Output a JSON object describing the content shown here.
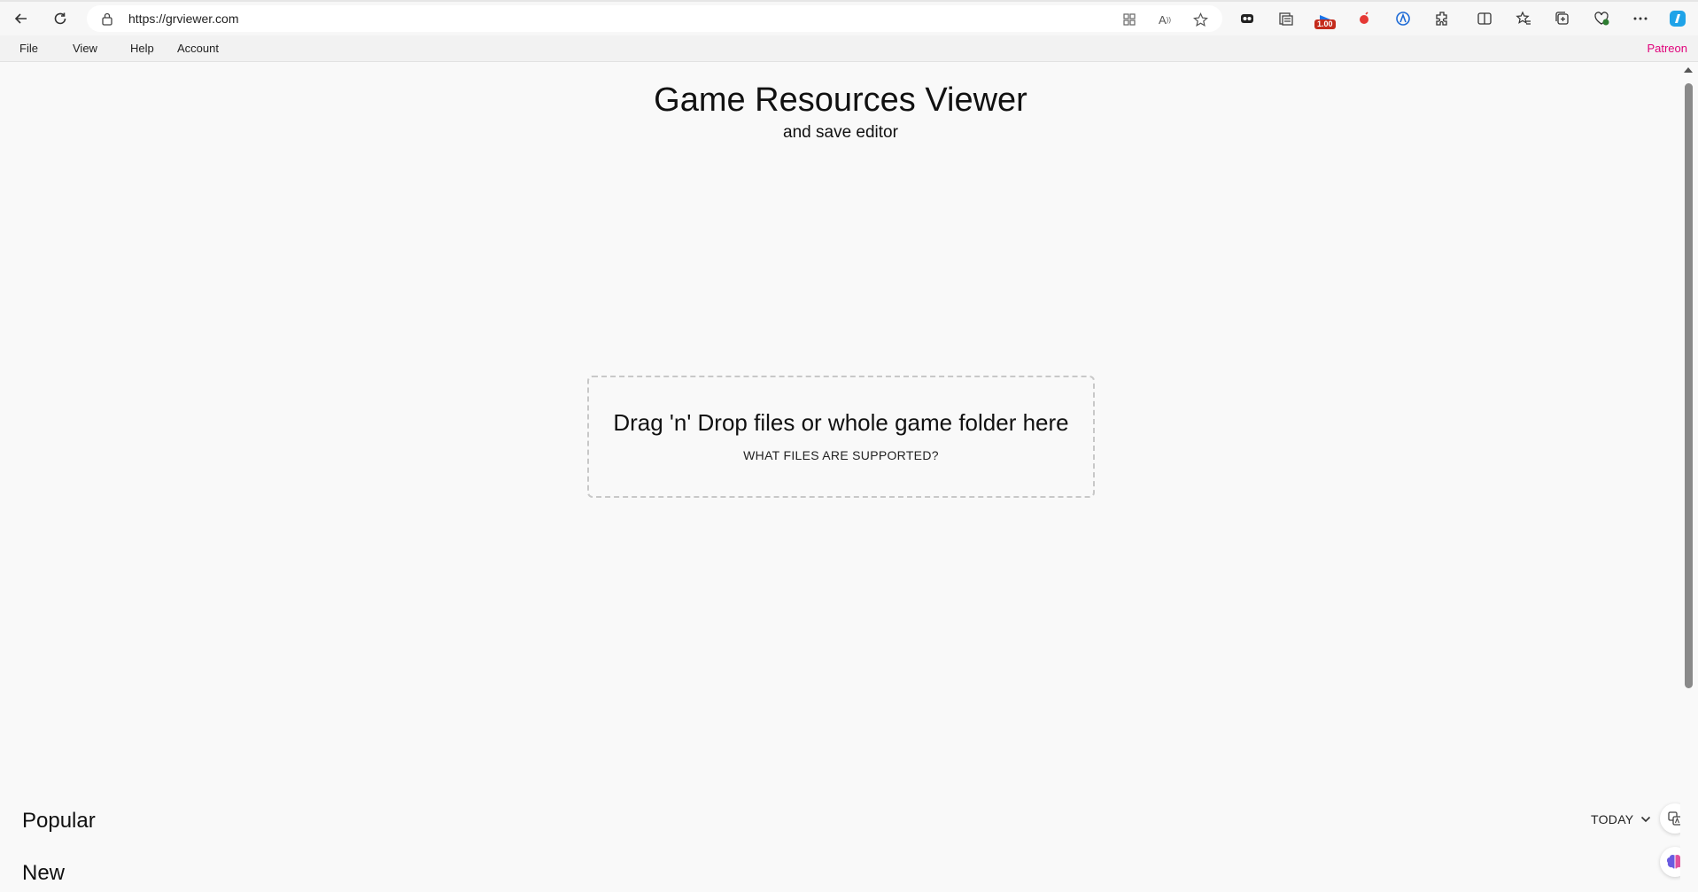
{
  "browser": {
    "url": "https://grviewer.com",
    "extension_badge": "1.00",
    "icons": [
      "back-icon",
      "refresh-icon",
      "lock-icon",
      "app-available-icon",
      "read-aloud-icon",
      "favorite-star-icon",
      "extension-1-icon",
      "extension-2-icon",
      "extension-3-icon",
      "extension-4-icon",
      "extension-5-icon",
      "extensions-puzzle-icon",
      "split-screen-icon",
      "favorites-icon",
      "collections-icon",
      "browser-essentials-icon",
      "more-icon",
      "copilot-icon"
    ]
  },
  "menubar": {
    "items": [
      "File",
      "View",
      "Help",
      "Account"
    ],
    "patreon": "Patreon"
  },
  "main": {
    "title": "Game Resources Viewer",
    "subtitle": "and save editor",
    "dropzone_text": "Drag 'n' Drop files or whole game folder here",
    "supported_link": "WHAT FILES ARE SUPPORTED?"
  },
  "sections": {
    "popular": "Popular",
    "new": "New",
    "period": "TODAY"
  },
  "colors": {
    "accent_patreon": "#e0007a",
    "page_bg": "#f9f9f9"
  }
}
